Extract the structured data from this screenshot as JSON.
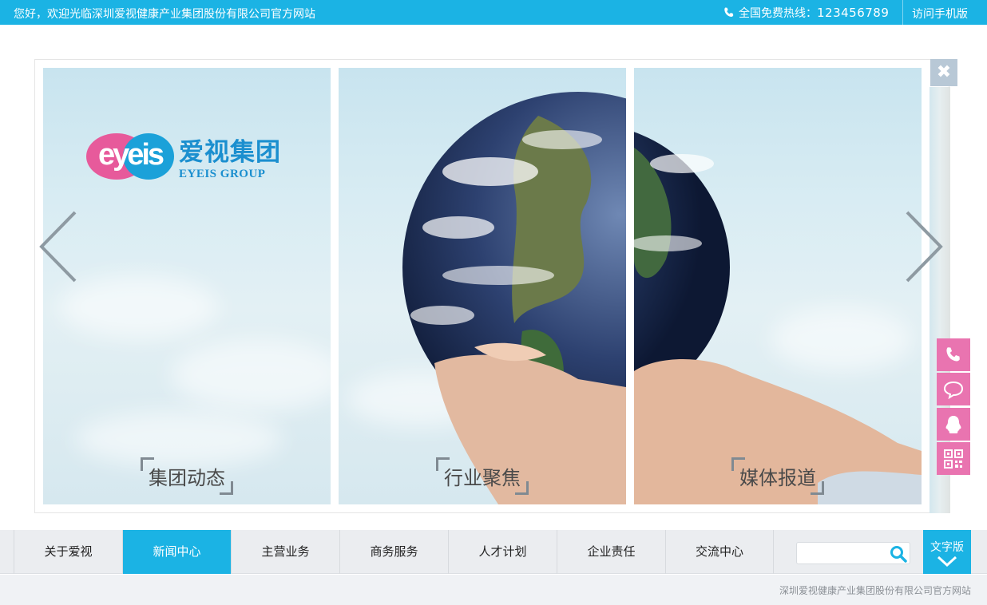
{
  "topbar": {
    "welcome": "您好，欢迎光临深圳爱视健康产业集团股份有限公司官方网站",
    "hotline_label": "全国免费热线：",
    "hotline_number": "123456789",
    "mobile_link": "访问手机版",
    "background": "#1bb3e4"
  },
  "banner": {
    "logo": {
      "text": "eyeis",
      "cn": "爱视集团",
      "en": "EYEIS GROUP"
    },
    "panels": [
      {
        "caption": "集团动态"
      },
      {
        "caption": "行业聚焦"
      },
      {
        "caption": "媒体报道"
      }
    ],
    "close_label": "✖",
    "icons": {
      "prev": "chevron-left-icon",
      "next": "chevron-right-icon",
      "close": "close-icon"
    }
  },
  "floating": [
    {
      "name": "phone-icon"
    },
    {
      "name": "chat-icon"
    },
    {
      "name": "qq-icon"
    },
    {
      "name": "qrcode-icon"
    }
  ],
  "nav": {
    "items": [
      {
        "label": "关于爱视"
      },
      {
        "label": "新闻中心",
        "active": true
      },
      {
        "label": "主营业务"
      },
      {
        "label": "商务服务"
      },
      {
        "label": "人才计划"
      },
      {
        "label": "企业责任"
      },
      {
        "label": "交流中心"
      }
    ],
    "search_placeholder": "",
    "text_version": "文字版"
  },
  "footer": {
    "text": "深圳爱视健康产业集团股份有限公司官方网站"
  },
  "colors": {
    "accent": "#1bb3e4",
    "pink": "#e974b0"
  }
}
